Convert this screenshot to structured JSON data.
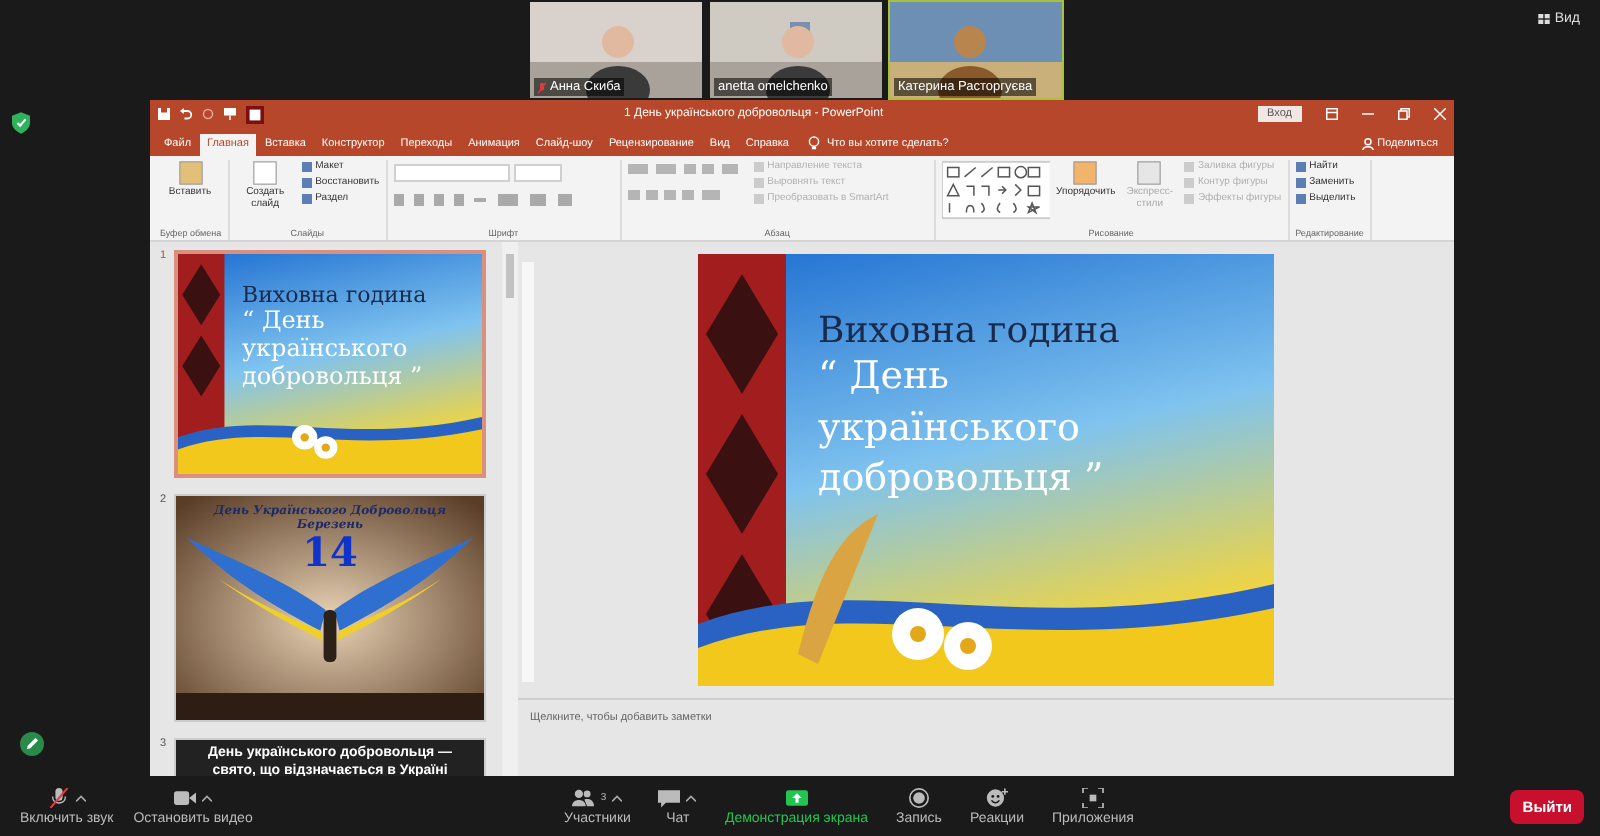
{
  "meeting": {
    "participants": [
      {
        "name": "Анна Скиба",
        "muted": true,
        "speaking": false
      },
      {
        "name": "anetta omelchenko",
        "muted": false,
        "speaking": false
      },
      {
        "name": "Катерина Расторгуєва",
        "muted": false,
        "speaking": true
      }
    ],
    "view_button": "Вид"
  },
  "powerpoint": {
    "title": "1 День українського добровольця  -  PowerPoint",
    "signin": "Вход",
    "tabs": [
      {
        "label": "Файл",
        "selected": false
      },
      {
        "label": "Главная",
        "selected": true
      },
      {
        "label": "Вставка",
        "selected": false
      },
      {
        "label": "Конструктор",
        "selected": false
      },
      {
        "label": "Переходы",
        "selected": false
      },
      {
        "label": "Анимация",
        "selected": false
      },
      {
        "label": "Слайд-шоу",
        "selected": false
      },
      {
        "label": "Рецензирование",
        "selected": false
      },
      {
        "label": "Вид",
        "selected": false
      },
      {
        "label": "Справка",
        "selected": false
      }
    ],
    "search": "Что вы хотите сделать?",
    "share": "Поделиться",
    "ribbon": [
      {
        "kind": "clipboard",
        "label": "Буфер обмена",
        "items": [
          {
            "label": "Вставить",
            "kind": "large",
            "disabled": false
          }
        ]
      },
      {
        "kind": "slides",
        "label": "Слайды",
        "items": [
          {
            "label": "Создать слайд",
            "kind": "large",
            "disabled": false
          },
          {
            "label": "Макет",
            "kind": "small",
            "disabled": false
          },
          {
            "label": "Восстановить",
            "kind": "small",
            "disabled": false
          },
          {
            "label": "Раздел",
            "kind": "small",
            "disabled": false
          }
        ]
      },
      {
        "kind": "font",
        "label": "Шрифт"
      },
      {
        "kind": "paragraph",
        "label": "Абзац",
        "items": [
          {
            "label": "Направление текста",
            "kind": "small",
            "disabled": true
          },
          {
            "label": "Выровнять текст",
            "kind": "small",
            "disabled": true
          },
          {
            "label": "Преобразовать в SmartArt",
            "kind": "small",
            "disabled": true
          }
        ]
      },
      {
        "kind": "drawing",
        "label": "Рисование",
        "items": [
          {
            "label": "Упорядочить",
            "kind": "large",
            "disabled": false
          },
          {
            "label": "Экспресс-стили",
            "kind": "large",
            "disabled": true
          },
          {
            "label": "Заливка фигуры",
            "kind": "small",
            "disabled": true
          },
          {
            "label": "Контур фигуры",
            "kind": "small",
            "disabled": true
          },
          {
            "label": "Эффекты фигуры",
            "kind": "small",
            "disabled": true
          }
        ]
      },
      {
        "kind": "editing",
        "label": "Редактирование",
        "items": [
          {
            "label": "Найти",
            "kind": "small",
            "disabled": false
          },
          {
            "label": "Заменить",
            "kind": "small",
            "disabled": false
          },
          {
            "label": "Выделить",
            "kind": "small",
            "disabled": false
          }
        ]
      }
    ],
    "thumbnails": [
      {
        "number": "1",
        "selected": true,
        "kind": "title",
        "lines": [
          "Виховна година",
          "“ День українського добровольця ”"
        ]
      },
      {
        "number": "2",
        "selected": false,
        "kind": "wings",
        "lines": [
          "День Українського Добровольця",
          "Березень",
          "14"
        ]
      },
      {
        "number": "3",
        "selected": false,
        "kind": "text",
        "lines": [
          "День українського добровольця —",
          "свято, що відзначається в Україні"
        ]
      }
    ],
    "slide": {
      "lines": [
        "Виховна година",
        "“ День українського добровольця ”"
      ]
    },
    "notes_placeholder": "Щелкните, чтобы добавить заметки"
  },
  "toolbar": {
    "items": [
      {
        "kind": "mic-muted",
        "label": "Включить звук",
        "caret": true
      },
      {
        "kind": "video",
        "label": "Остановить видео",
        "caret": true
      },
      {
        "kind": "participants",
        "label": "Участники",
        "caret": true,
        "count": "3"
      },
      {
        "kind": "chat",
        "label": "Чат",
        "caret": true
      },
      {
        "kind": "share",
        "label": "Демонстрация экрана",
        "caret": false
      },
      {
        "kind": "record",
        "label": "Запись",
        "caret": false
      },
      {
        "kind": "reactions",
        "label": "Реакции",
        "caret": false
      },
      {
        "kind": "apps",
        "label": "Приложения",
        "caret": false
      }
    ],
    "leave": "Выйти"
  }
}
